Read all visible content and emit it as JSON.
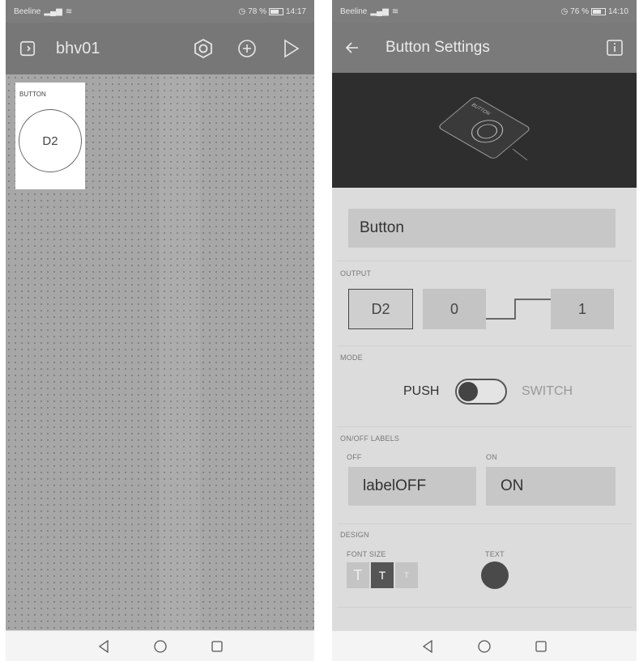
{
  "left_screen": {
    "status": {
      "carrier": "Beeline",
      "battery": "78 %",
      "time": "14:17"
    },
    "project_title": "bhv01",
    "widget": {
      "label": "BUTTON",
      "pin": "D2"
    }
  },
  "right_screen": {
    "status": {
      "carrier": "Beeline",
      "battery": "76 %",
      "time": "14:10"
    },
    "header_title": "Button Settings",
    "banner_device_text": "BUTTON",
    "name_value": "Button",
    "output": {
      "section_label": "OUTPUT",
      "pin": "D2",
      "low_value": "0",
      "high_value": "1"
    },
    "mode": {
      "section_label": "MODE",
      "push_label": "PUSH",
      "switch_label": "SWITCH",
      "selected": "PUSH"
    },
    "labels": {
      "section_label": "ON/OFF LABELS",
      "off_caption": "OFF",
      "on_caption": "ON",
      "off_value": "labelOFF",
      "on_value": "ON"
    },
    "design": {
      "section_label": "DESIGN",
      "font_size_caption": "FONT SIZE",
      "text_caption": "TEXT",
      "font_sizes": [
        "T",
        "T",
        "T"
      ],
      "selected_font_size_index": 1,
      "text_color": "#4a4a4a"
    }
  },
  "icons": [
    "back-arrow-icon",
    "info-icon",
    "project-icon",
    "settings-hex-icon",
    "add-circle-icon",
    "play-icon",
    "nav-back-icon",
    "nav-home-icon",
    "nav-recents-icon"
  ]
}
